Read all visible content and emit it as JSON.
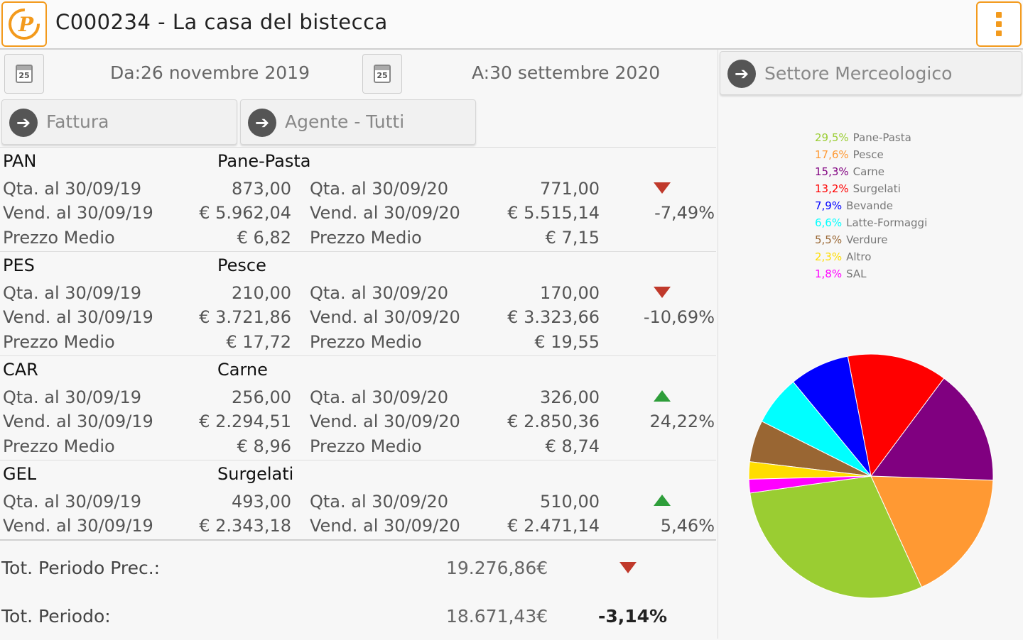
{
  "header": {
    "title": "C000234 - La casa del bistecca"
  },
  "filters": {
    "date_from": "Da:26 novembre 2019",
    "date_to": "A:30 settembre 2020",
    "calendar_day": "25",
    "document_type": "Fattura",
    "agent": "Agente - Tutti",
    "sector": "Settore Merceologico"
  },
  "rows": [
    {
      "code": "PAN",
      "name": "Pane-Pasta",
      "qty_prev_label": "Qta. al 30/09/19",
      "qty_prev": "873,00",
      "qty_curr_label": "Qta. al 30/09/20",
      "qty_curr": "771,00",
      "sales_prev_label": "Vend. al 30/09/19",
      "sales_prev": "€ 5.962,04",
      "sales_curr_label": "Vend. al 30/09/20",
      "sales_curr": "€ 5.515,14",
      "avg_label": "Prezzo Medio",
      "avg_prev": "€ 6,82",
      "avg_curr": "€ 7,15",
      "change": "-7,49%",
      "trend": "down"
    },
    {
      "code": "PES",
      "name": "Pesce",
      "qty_prev_label": "Qta. al 30/09/19",
      "qty_prev": "210,00",
      "qty_curr_label": "Qta. al 30/09/20",
      "qty_curr": "170,00",
      "sales_prev_label": "Vend. al 30/09/19",
      "sales_prev": "€ 3.721,86",
      "sales_curr_label": "Vend. al 30/09/20",
      "sales_curr": "€ 3.323,66",
      "avg_label": "Prezzo Medio",
      "avg_prev": "€ 17,72",
      "avg_curr": "€ 19,55",
      "change": "-10,69%",
      "trend": "down"
    },
    {
      "code": "CAR",
      "name": "Carne",
      "qty_prev_label": "Qta. al 30/09/19",
      "qty_prev": "256,00",
      "qty_curr_label": "Qta. al 30/09/20",
      "qty_curr": "326,00",
      "sales_prev_label": "Vend. al 30/09/19",
      "sales_prev": "€ 2.294,51",
      "sales_curr_label": "Vend. al 30/09/20",
      "sales_curr": "€ 2.850,36",
      "avg_label": "Prezzo Medio",
      "avg_prev": "€ 8,96",
      "avg_curr": "€ 8,74",
      "change": "24,22%",
      "trend": "up"
    },
    {
      "code": "GEL",
      "name": "Surgelati",
      "qty_prev_label": "Qta. al 30/09/19",
      "qty_prev": "493,00",
      "qty_curr_label": "Qta. al 30/09/20",
      "qty_curr": "510,00",
      "sales_prev_label": "Vend. al 30/09/19",
      "sales_prev": "€ 2.343,18",
      "sales_curr_label": "Vend. al 30/09/20",
      "sales_curr": "€ 2.471,14",
      "change": "5,46%",
      "trend": "up"
    }
  ],
  "totals": {
    "prev_label": "Tot. Periodo Prec.:",
    "prev_value": "19.276,86€",
    "curr_label": "Tot. Periodo:",
    "curr_value": "18.671,43€",
    "change": "-3,14%",
    "trend": "down"
  },
  "chart_data": {
    "type": "pie",
    "slices": [
      {
        "label": "Pane-Pasta",
        "pct_text": "29,5%",
        "value": 29.5,
        "color": "#9acd32"
      },
      {
        "label": "Pesce",
        "pct_text": "17,6%",
        "value": 17.6,
        "color": "#ff9933"
      },
      {
        "label": "Carne",
        "pct_text": "15,3%",
        "value": 15.3,
        "color": "#800080"
      },
      {
        "label": "Surgelati",
        "pct_text": "13,2%",
        "value": 13.2,
        "color": "#ff0000"
      },
      {
        "label": "Bevande",
        "pct_text": "7,9%",
        "value": 7.9,
        "color": "#0000ff"
      },
      {
        "label": "Latte-Formaggi",
        "pct_text": "6,6%",
        "value": 6.6,
        "color": "#00ffff"
      },
      {
        "label": "Verdure",
        "pct_text": "5,5%",
        "value": 5.5,
        "color": "#996633"
      },
      {
        "label": "Altro",
        "pct_text": "2,3%",
        "value": 2.3,
        "color": "#ffdd00"
      },
      {
        "label": "SAL",
        "pct_text": "1,8%",
        "value": 1.8,
        "color": "#ff00ff"
      }
    ]
  }
}
